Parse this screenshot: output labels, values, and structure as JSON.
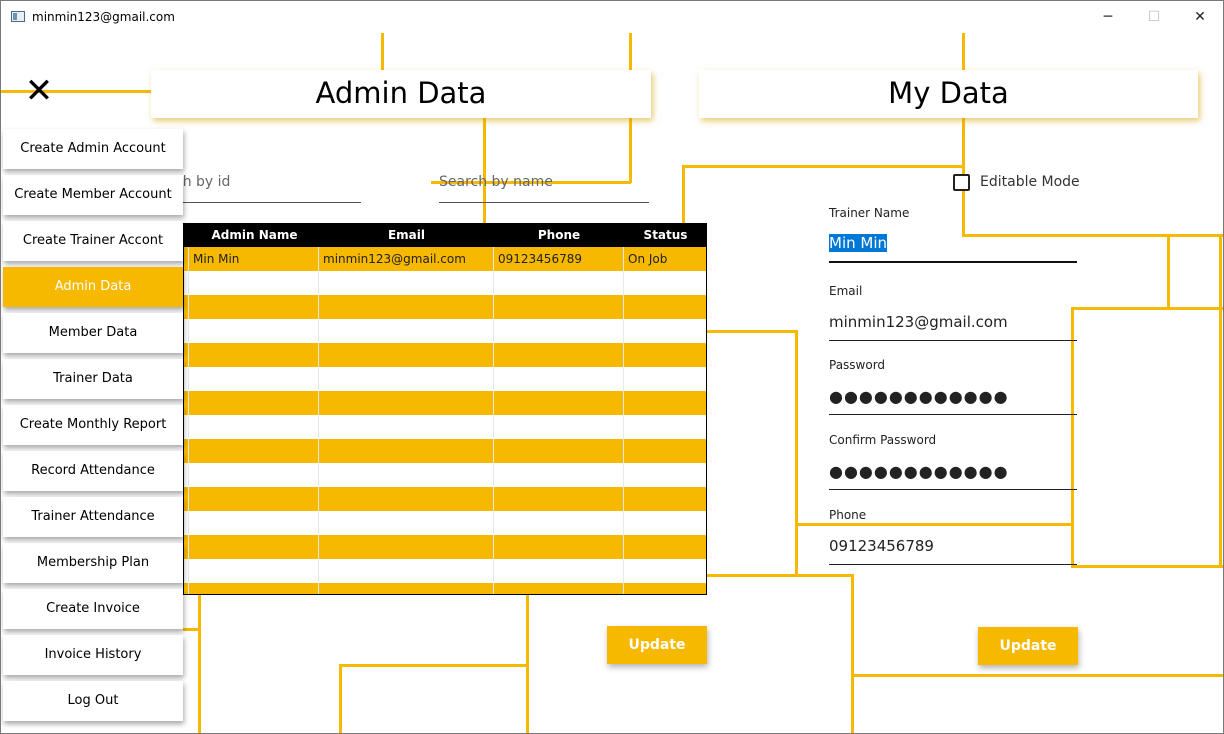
{
  "window": {
    "title": "minmin123@gmail.com",
    "controls": {
      "minimize": "─",
      "maximize": "☐",
      "close": "✕"
    }
  },
  "close_menu_icon": "✕",
  "headers": {
    "admin": "Admin Data",
    "mine": "My Data"
  },
  "menu": [
    {
      "label": "Create Admin Account",
      "active": false
    },
    {
      "label": "Create Member Account",
      "active": false
    },
    {
      "label": "Create Trainer Accont",
      "active": false
    },
    {
      "label": "Admin Data",
      "active": true
    },
    {
      "label": "Member Data",
      "active": false
    },
    {
      "label": "Trainer Data",
      "active": false
    },
    {
      "label": "Create Monthly Report",
      "active": false
    },
    {
      "label": "Record Attendance",
      "active": false
    },
    {
      "label": "Trainer Attendance",
      "active": false
    },
    {
      "label": "Membership Plan",
      "active": false
    },
    {
      "label": "Create Invoice",
      "active": false
    },
    {
      "label": "Invoice History",
      "active": false
    },
    {
      "label": "Log Out",
      "active": false
    }
  ],
  "search": {
    "id_visible_text": "ch by id",
    "name_placeholder": "Search by name"
  },
  "table": {
    "columns": [
      "Admin Name",
      "Email",
      "Phone",
      "Status"
    ],
    "rows": [
      [
        "Min Min",
        "minmin123@gmail.com",
        "09123456789",
        "On Job"
      ]
    ]
  },
  "my_data": {
    "editable_label": "Editable Mode",
    "editable_checked": false,
    "fields": {
      "trainer_name_label": "Trainer Name",
      "trainer_name_value": "Min Min",
      "email_label": "Email",
      "email_value": "minmin123@gmail.com",
      "password_label": "Password",
      "password_value": "●●●●●●●●●●●●",
      "confirm_label": "Confirm Password",
      "confirm_value": "●●●●●●●●●●●●",
      "phone_label": "Phone",
      "phone_value": "09123456789"
    }
  },
  "buttons": {
    "update_admin": "Update",
    "update_mine": "Update"
  },
  "colors": {
    "accent": "#f7b800",
    "selection": "#0078d7"
  }
}
